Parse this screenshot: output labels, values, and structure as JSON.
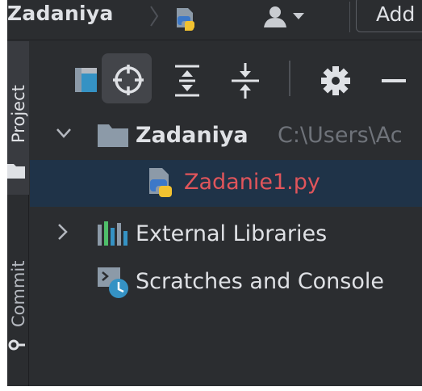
{
  "navbar": {
    "project_name": "Zadaniya",
    "run_config_label": "Add"
  },
  "toolwindow_strip": {
    "project_label": "Project",
    "commit_label": "Commit"
  },
  "toolbar": {
    "buttons": [
      "project-view-icon",
      "locate-icon",
      "expand-all-icon",
      "collapse-all-icon",
      "gear-icon",
      "hide-icon"
    ]
  },
  "tree": {
    "root": {
      "name": "Zadaniya",
      "path": "C:\\Users\\Ac"
    },
    "file": {
      "name": "Zadanie1.py"
    },
    "external_libraries": "External Libraries",
    "scratches": "Scratches and Console"
  },
  "colors": {
    "background": "#2b2d30",
    "selection": "#1f3348",
    "error_file": "#e0555b",
    "path_text": "#6f737a",
    "scratch_badge": "#3592c4"
  }
}
